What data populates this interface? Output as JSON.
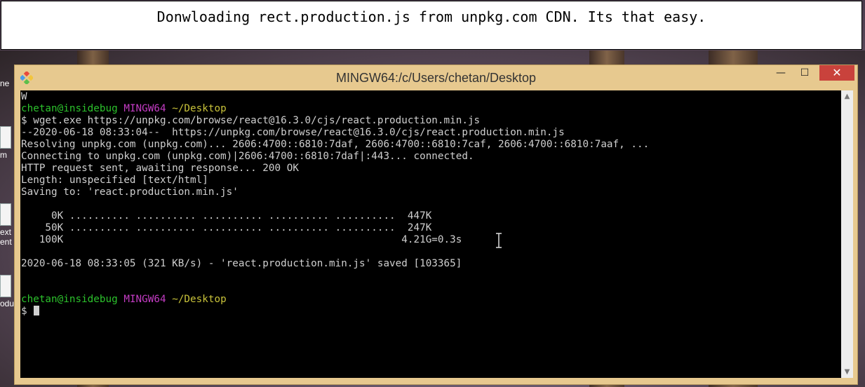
{
  "banner": {
    "text": "Donwloading rect.production.js from unpkg.com CDN. Its that easy."
  },
  "desktop": {
    "icons": [
      {
        "label": "ne"
      },
      {
        "label": "m"
      },
      {
        "label": "ext"
      },
      {
        "label": "ent"
      },
      {
        "label": "odu"
      }
    ]
  },
  "window": {
    "title": "MINGW64:/c/Users/chetan/Desktop",
    "controls": {
      "minimize": "—",
      "maximize": "☐",
      "close": "✕"
    }
  },
  "terminal": {
    "prev_line": "W",
    "prompt1": {
      "user": "chetan@insidebug",
      "host": "MINGW64",
      "path": "~/Desktop"
    },
    "command": "$ wget.exe https://unpkg.com/browse/react@16.3.0/cjs/react.production.min.js",
    "output": [
      "--2020-06-18 08:33:04--  https://unpkg.com/browse/react@16.3.0/cjs/react.production.min.js",
      "Resolving unpkg.com (unpkg.com)... 2606:4700::6810:7daf, 2606:4700::6810:7caf, 2606:4700::6810:7aaf, ...",
      "Connecting to unpkg.com (unpkg.com)|2606:4700::6810:7daf|:443... connected.",
      "HTTP request sent, awaiting response... 200 OK",
      "Length: unspecified [text/html]",
      "Saving to: 'react.production.min.js'"
    ],
    "progress": [
      "     0K .......... .......... .......... .......... ..........  447K",
      "    50K .......... .......... .......... .......... ..........  247K",
      "   100K                                                        4.21G=0.3s"
    ],
    "saved_line": "2020-06-18 08:33:05 (321 KB/s) - 'react.production.min.js' saved [103365]",
    "prompt2": {
      "user": "chetan@insidebug",
      "host": "MINGW64",
      "path": "~/Desktop"
    },
    "input_prompt": "$"
  },
  "colors": {
    "user": "#2cc22c",
    "host": "#c43cc4",
    "path": "#c8c23a",
    "close": "#c9423c",
    "frame": "#e7c98f"
  }
}
